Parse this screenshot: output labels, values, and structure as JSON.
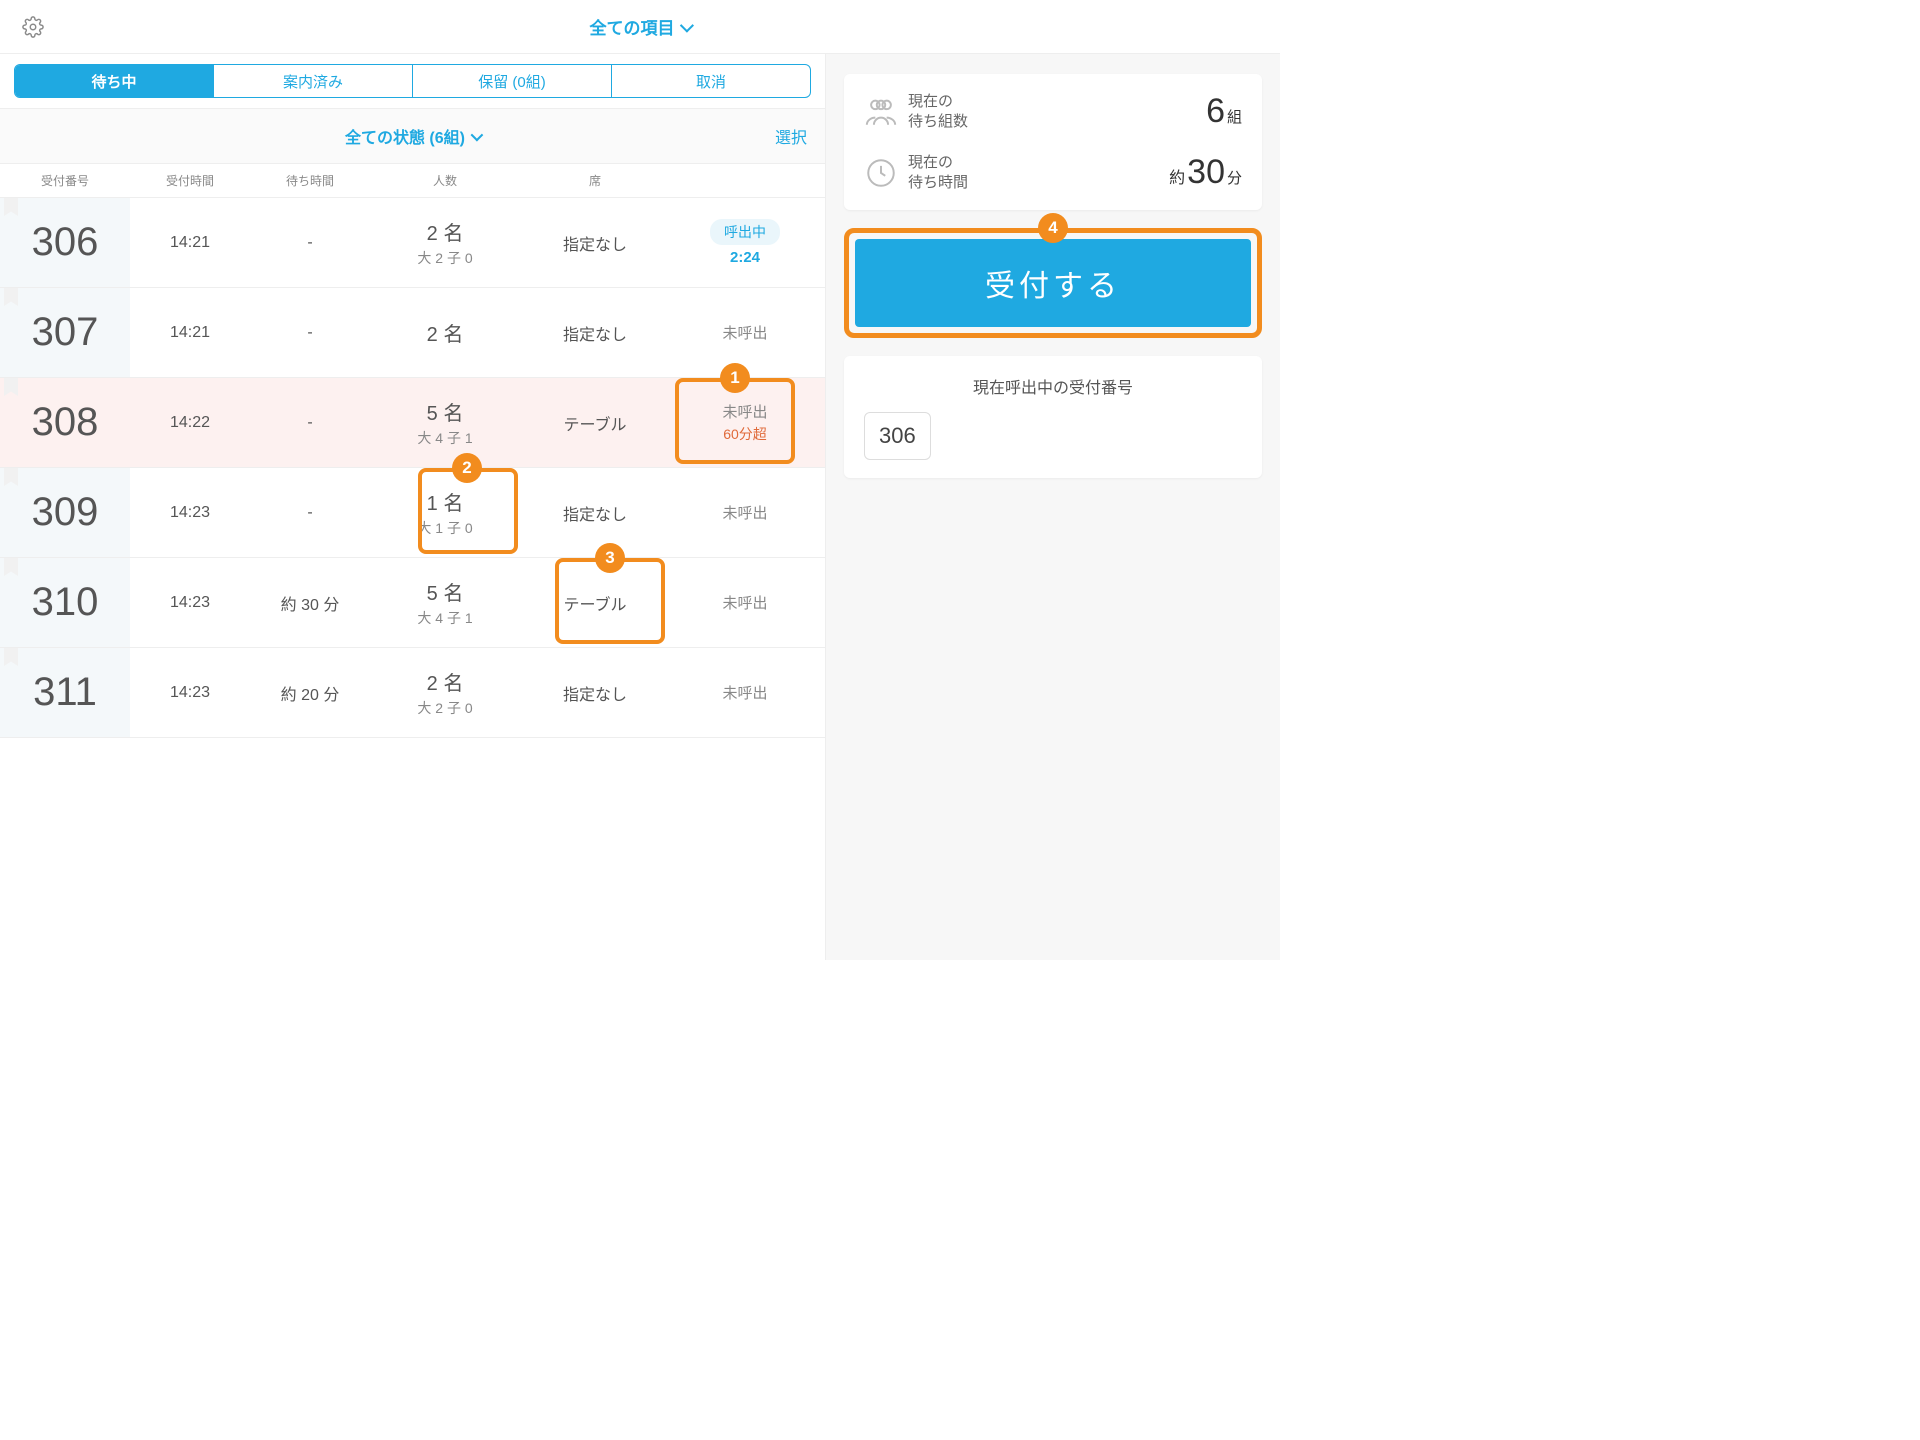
{
  "header": {
    "filter_label": "全ての項目"
  },
  "tabs": {
    "waiting": "待ち中",
    "guided": "案内済み",
    "hold": "保留 (0組)",
    "cancel": "取消"
  },
  "subfilter": {
    "label": "全ての状態 (6組)",
    "select": "選択"
  },
  "columns": {
    "id": "受付番号",
    "time": "受付時間",
    "wait": "待ち時間",
    "people": "人数",
    "seat": "席"
  },
  "status_labels": {
    "calling": "呼出中",
    "uncalled": "未呼出",
    "over60": "60分超"
  },
  "rows": [
    {
      "id": "306",
      "time": "14:21",
      "wait": "-",
      "people_main": "2 名",
      "people_sub": "大 2 子 0",
      "seat": "指定なし",
      "status": "calling",
      "timer": "2:24"
    },
    {
      "id": "307",
      "time": "14:21",
      "wait": "-",
      "people_main": "2 名",
      "people_sub": "",
      "seat": "指定なし",
      "status": "uncalled"
    },
    {
      "id": "308",
      "time": "14:22",
      "wait": "-",
      "people_main": "5 名",
      "people_sub": "大 4 子 1",
      "seat": "テーブル",
      "status": "uncalled_over",
      "pink": true
    },
    {
      "id": "309",
      "time": "14:23",
      "wait": "-",
      "people_main": "1 名",
      "people_sub": "大 1 子 0",
      "seat": "指定なし",
      "status": "uncalled"
    },
    {
      "id": "310",
      "time": "14:23",
      "wait": "約 30 分",
      "people_main": "5 名",
      "people_sub": "大 4 子 1",
      "seat": "テーブル",
      "status": "uncalled"
    },
    {
      "id": "311",
      "time": "14:23",
      "wait": "約 20 分",
      "people_main": "2 名",
      "people_sub": "大 2 子 0",
      "seat": "指定なし",
      "status": "uncalled"
    }
  ],
  "sidebar": {
    "groups_label1": "現在の",
    "groups_label2": "待ち組数",
    "groups_value": "6",
    "groups_unit": "組",
    "wait_label1": "現在の",
    "wait_label2": "待ち時間",
    "wait_pre": "約",
    "wait_value": "30",
    "wait_unit": "分",
    "cta": "受付する",
    "calling_title": "現在呼出中の受付番号",
    "calling_number": "306"
  },
  "callouts": {
    "1": "1",
    "2": "2",
    "3": "3",
    "4": "4"
  }
}
